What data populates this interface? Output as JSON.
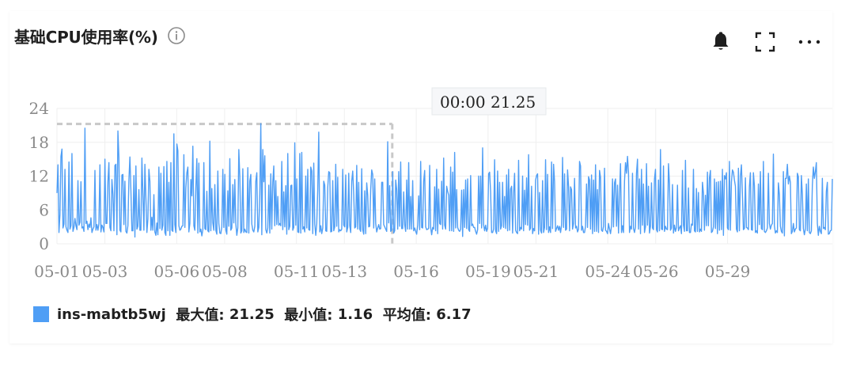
{
  "header": {
    "title": "基础CPU使用率(%)"
  },
  "icons": {
    "info": "info-circle-icon",
    "alert": "bell-icon",
    "fullscreen": "fullscreen-icon",
    "more": "more-horizontal-icon"
  },
  "colors": {
    "series": "#4f9ef5",
    "crosshair": "#c8c8c8",
    "grid": "#efefef"
  },
  "tooltip": {
    "text": "00:00 21.25"
  },
  "legend": {
    "series_name": "ins-mabtb5wj",
    "max_label": "最大值:",
    "max_value": "21.25",
    "min_label": "最小值:",
    "min_value": "1.16",
    "avg_label": "平均值:",
    "avg_value": "6.17"
  },
  "chart_data": {
    "type": "line",
    "title": "基础CPU使用率(%)",
    "xlabel": "",
    "ylabel": "",
    "ylim": [
      0,
      24
    ],
    "y_ticks": [
      "0",
      "6",
      "12",
      "18",
      "24"
    ],
    "x_range": [
      "05-01",
      "05-31"
    ],
    "x_ticks": [
      "05-01",
      "05-03",
      "05-06",
      "05-08",
      "05-11",
      "05-13",
      "05-16",
      "05-19",
      "05-21",
      "05-24",
      "05-26",
      "05-29"
    ],
    "grid": true,
    "legend_position": "bottom-left",
    "highlight": {
      "x": "05-15 00:00",
      "y": 21.25
    },
    "series": [
      {
        "name": "ins-mabtb5wj",
        "stats": {
          "max": 21.25,
          "min": 1.16,
          "avg": 6.17
        },
        "points_per_day": 24,
        "values": [
          9.0,
          14.0,
          2.0,
          5.2,
          15.5,
          16.8,
          2.8,
          3.5,
          13.2,
          3.0,
          2.4,
          2.0,
          14.5,
          2.6,
          3.2,
          16.0,
          2.2,
          2.9,
          4.5,
          3.2,
          2.5,
          11.2,
          3.3,
          3.8,
          11.0,
          2.8,
          3.0,
          2.2,
          20.5,
          3.6,
          4.0,
          2.5,
          3.5,
          2.9,
          4.6,
          2.0,
          2.6,
          3.0,
          13.0,
          2.4,
          3.4,
          2.4,
          3.6,
          14.0,
          2.1,
          3.3,
          2.9,
          2.1,
          15.0,
          3.6,
          3.6,
          11.0,
          14.4,
          2.9,
          2.3,
          11.4,
          8.8,
          2.3,
          13.9,
          14.1,
          1.6,
          20.0,
          15.3,
          2.4,
          2.1,
          12.2,
          12.3,
          3.4,
          11.1,
          2.2,
          1.9,
          3.2,
          11.3,
          15.4,
          9.5,
          2.3,
          2.3,
          12.1,
          1.2,
          13.8,
          2.6,
          3.1,
          9.6,
          2.4,
          2.4,
          15.2,
          8.9,
          2.4,
          14.1,
          8.2,
          2.0,
          4.4,
          13.2,
          11.1,
          2.4,
          4.7,
          2.4,
          8.7,
          2.1,
          1.5,
          3.7,
          1.6,
          13.6,
          2.7,
          12.5,
          2.4,
          3.3,
          13.7,
          2.0,
          1.5,
          14.6,
          2.3,
          10.9,
          1.5,
          14.4,
          2.4,
          2.2,
          19.5,
          3.4,
          2.0,
          17.7,
          16.5,
          3.2,
          2.4,
          2.6,
          3.1,
          3.2,
          15.8,
          2.9,
          9.9,
          12.6,
          13.6,
          2.1,
          3.6,
          11.4,
          8.5,
          17.3,
          3.2,
          2.4,
          9.9,
          15.1,
          1.9,
          14.3,
          2.1,
          2.6,
          1.4,
          2.5,
          14.4,
          2.7,
          2.5,
          9.3,
          2.3,
          2.1,
          18.2,
          2.3,
          9.8,
          3.7,
          2.4,
          10.5,
          2.4,
          1.7,
          12.9,
          3.6,
          1.9,
          1.8,
          3.0,
          13.2,
          2.9,
          12.3,
          2.4,
          1.7,
          9.4,
          3.1,
          15.1,
          2.4,
          2.8,
          10.5,
          3.7,
          11.4,
          3.5,
          1.5,
          2.8,
          16.7,
          11.9,
          1.9,
          2.3,
          13.3,
          2.0,
          2.6,
          2.1,
          2.0,
          13.5,
          1.9,
          11.1,
          12.3,
          3.5,
          2.4,
          2.1,
          3.1,
          11.1,
          12.6,
          2.1,
          2.9,
          8.8,
          21.3,
          1.6,
          16.7,
          11.0,
          15.6,
          2.5,
          1.9,
          2.8,
          10.4,
          1.9,
          12.4,
          2.6,
          10.9,
          13.8,
          3.2,
          11.2,
          3.4,
          8.4,
          3.3,
          3.6,
          3.2,
          14.6,
          2.5,
          9.2,
          3.0,
          10.3,
          1.7,
          16.0,
          2.5,
          3.1,
          10.3,
          10.4,
          2.4,
          2.9,
          17.9,
          3.3,
          11.5,
          2.1,
          2.0,
          16.0,
          1.9,
          16.2,
          2.6,
          3.0,
          2.1,
          12.0,
          2.8,
          13.2,
          2.5,
          2.4,
          13.6,
          12.9,
          1.8,
          14.3,
          3.5,
          1.5,
          3.5,
          9.5,
          19.8,
          2.1,
          3.2,
          1.8,
          2.8,
          11.1,
          10.4,
          2.3,
          2.2,
          10.0,
          12.8,
          12.6,
          2.1,
          2.2,
          11.2,
          2.3,
          3.0,
          14.1,
          3.1,
          11.8,
          2.1,
          2.5,
          2.3,
          2.6,
          13.2,
          3.3,
          3.0,
          12.2,
          2.1,
          2.9,
          12.5,
          3.2,
          2.0,
          11.1,
          12.9,
          8.7,
          2.8,
          3.0,
          13.9,
          2.6,
          10.9,
          2.6,
          2.2,
          13.3,
          2.5,
          1.7,
          9.4,
          1.8,
          10.8,
          8.6,
          3.0,
          3.1,
          9.6,
          13.1,
          12.3,
          2.8,
          11.5,
          3.6,
          2.1,
          2.8,
          3.4,
          2.6,
          2.7,
          10.9,
          10.9,
          3.4,
          3.0,
          2.6,
          2.2,
          18.1,
          3.7,
          10.3,
          2.2,
          2.4,
          12.8,
          1.9,
          2.3,
          11.3,
          9.6,
          2.6,
          12.8,
          3.1,
          14.5,
          2.7,
          2.7,
          9.2,
          3.4,
          2.2,
          11.3,
          2.6,
          14.4,
          2.6,
          8.4,
          2.6,
          11.2,
          2.3,
          2.8,
          2.2,
          1.7,
          3.3,
          8.5,
          2.5,
          14.6,
          2.9,
          2.8,
          11.1,
          13.0,
          3.0,
          2.5,
          2.6,
          2.7,
          13.9,
          2.9,
          1.6,
          2.9,
          2.6,
          10.1,
          2.3,
          13.2,
          1.8,
          9.7,
          3.6,
          3.4,
          11.1,
          2.6,
          15.2,
          3.3,
          2.6,
          10.2,
          9.3,
          8.6,
          2.3,
          13.6,
          2.3,
          12.7,
          2.2,
          16.2,
          2.8,
          9.6,
          2.9,
          2.4,
          2.2,
          2.6,
          9.5,
          1.3,
          9.6,
          2.9,
          11.3,
          2.7,
          11.5,
          2.5,
          2.2,
          12.1,
          3.2,
          3.5,
          2.9,
          2.9,
          2.2,
          1.7,
          2.5,
          12.0,
          3.6,
          12.0,
          2.8,
          17.0,
          3.4,
          2.3,
          3.3,
          2.2,
          2.8,
          12.4,
          12.7,
          9.2,
          2.0,
          2.0,
          2.6,
          14.9,
          2.3,
          1.8,
          12.9,
          2.2,
          10.9,
          2.6,
          3.2,
          10.9,
          2.9,
          8.4,
          2.7,
          12.2,
          2.3,
          13.2,
          2.4,
          9.7,
          10.2,
          1.9,
          8.9,
          12.5,
          2.4,
          2.0,
          1.8,
          14.8,
          2.3,
          2.9,
          2.6,
          12.0,
          2.3,
          9.5,
          3.4,
          11.7,
          3.3,
          15.8,
          2.4,
          2.8,
          10.2,
          1.8,
          2.7,
          2.3,
          11.3,
          12.1,
          12.4,
          1.7,
          9.1,
          2.4,
          1.9,
          11.2,
          2.0,
          2.9,
          14.9,
          2.5,
          12.3,
          2.0,
          3.0,
          2.0,
          14.5,
          2.7,
          14.1,
          11.0,
          2.2,
          2.7,
          3.2,
          2.4,
          3.1,
          2.0,
          3.3,
          15.3,
          2.9,
          12.4,
          2.4,
          2.6,
          13.1,
          10.2,
          2.3,
          10.1,
          9.6,
          2.6,
          3.6,
          11.6,
          2.8,
          3.1,
          2.1,
          2.6,
          14.6,
          13.8,
          2.4,
          3.1,
          2.0,
          2.0,
          3.1,
          10.6,
          2.9,
          11.9,
          11.3,
          2.6,
          12.2,
          1.8,
          11.3,
          2.2,
          14.0,
          2.2,
          9.6,
          2.0,
          13.0,
          11.8,
          2.4,
          2.2,
          3.1,
          13.4,
          2.4,
          2.2,
          1.8,
          3.6,
          2.6,
          1.8,
          3.2,
          11.5,
          3.0,
          10.8,
          11.5,
          3.1,
          10.4,
          1.9,
          8.9,
          14.2,
          2.0,
          3.2,
          2.0,
          11.1,
          14.4,
          12.5,
          15.5,
          12.6,
          2.0,
          3.1,
          2.6,
          12.5,
          2.7,
          2.0,
          3.0,
          12.5,
          15.0,
          2.6,
          11.5,
          1.8,
          13.2,
          3.3,
          10.6,
          2.0,
          3.0,
          14.2,
          3.3,
          10.2,
          1.9,
          3.1,
          10.8,
          2.8,
          2.5,
          11.5,
          13.2,
          2.5,
          2.1,
          11.3,
          2.3,
          16.7,
          2.6,
          2.5,
          13.8,
          2.2,
          3.1,
          2.6,
          2.5,
          14.2,
          10.6,
          2.4,
          2.8,
          10.5,
          1.9,
          3.3,
          2.2,
          2.9,
          10.4,
          2.3,
          2.8,
          3.2,
          1.8,
          13.0,
          3.3,
          2.2,
          14.8,
          2.3,
          2.3,
          9.9,
          2.0,
          2.0,
          3.5,
          3.3,
          13.2,
          2.3,
          2.1,
          9.8,
          2.2,
          9.1,
          2.1,
          2.6,
          2.2,
          10.9,
          9.0,
          2.4,
          8.6,
          3.2,
          12.7,
          3.2,
          11.7,
          13.0,
          2.0,
          2.2,
          3.0,
          11.5,
          2.7,
          10.9,
          1.8,
          11.0,
          2.4,
          11.1,
          2.5,
          13.2,
          1.5,
          12.1,
          11.5,
          12.6,
          2.8,
          2.5,
          14.6,
          2.4,
          10.9,
          13.1,
          12.7,
          11.3,
          10.2,
          2.6,
          2.1,
          13.4,
          2.3,
          11.9,
          14.0,
          8.8,
          2.5,
          2.7,
          11.7,
          2.9,
          2.8,
          2.5,
          10.1,
          12.6,
          2.5,
          2.4,
          12.6,
          10.3,
          2.0,
          2.3,
          1.9,
          10.6,
          3.4,
          12.8,
          2.7,
          2.5,
          14.6,
          2.2,
          2.0,
          2.3,
          2.8,
          12.5,
          3.6,
          2.6,
          3.3,
          3.6,
          15.9,
          3.2,
          1.9,
          2.3,
          2.0,
          10.8,
          8.7,
          3.1,
          2.2,
          1.9,
          12.8,
          1.4,
          11.6,
          11.6,
          14.1,
          10.6,
          12.0,
          10.9,
          1.8,
          2.2,
          3.6,
          2.1,
          2.6,
          2.8,
          12.5,
          11.9,
          2.5,
          2.3,
          12.1,
          8.7,
          2.7,
          1.6,
          2.6,
          10.6,
          2.3,
          11.5,
          2.0,
          1.8,
          2.3,
          10.4,
          13.6,
          11.6,
          12.8,
          14.4,
          3.6,
          1.5,
          3.1,
          2.2,
          1.8,
          11.6,
          2.7,
          2.9,
          2.5,
          9.3,
          10.9,
          1.7,
          1.8,
          2.3,
          2.4,
          11.5
        ]
      }
    ]
  }
}
